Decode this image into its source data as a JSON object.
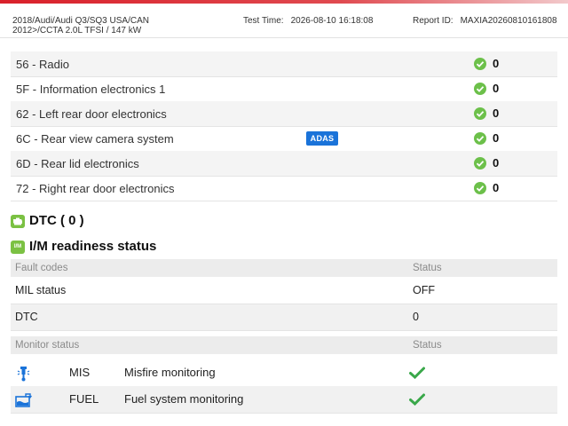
{
  "header": {
    "vehicle_line1": "2018/Audi/Audi Q3/SQ3 USA/CAN",
    "vehicle_line2": "2012>/CCTA 2.0L TFSI / 147 kW",
    "test_time_label": "Test Time:",
    "test_time_value": "2026-08-10 16:18:08",
    "report_id_label": "Report ID:",
    "report_id_value": "MAXIA20260810161808"
  },
  "systems": [
    {
      "name": "56 - Radio",
      "count": "0"
    },
    {
      "name": "5F - Information electronics 1",
      "count": "0"
    },
    {
      "name": "62 - Left rear door electronics",
      "count": "0"
    },
    {
      "name": "6C - Rear view camera system",
      "count": "0",
      "badge": "ADAS"
    },
    {
      "name": "6D - Rear lid electronics",
      "count": "0"
    },
    {
      "name": "72 - Right rear door electronics",
      "count": "0"
    }
  ],
  "dtc_section": {
    "title": "DTC ( 0 )"
  },
  "im_section": {
    "title": "I/M readiness status",
    "icon_text": "I/M",
    "fault_codes_header": "Fault codes",
    "status_header": "Status",
    "rows": [
      {
        "label": "MIL status",
        "value": "OFF"
      },
      {
        "label": "DTC",
        "value": "0"
      }
    ],
    "monitor_header": "Monitor status",
    "monitor_status_header": "Status",
    "monitors": [
      {
        "abbr": "MIS",
        "name": "Misfire monitoring",
        "icon": "misfire-icon"
      },
      {
        "abbr": "FUEL",
        "name": "Fuel system monitoring",
        "icon": "fuel-system-icon"
      }
    ]
  },
  "colors": {
    "accent_red": "#d9202a",
    "ok_green": "#6cc04a",
    "adas_blue": "#1a73d9",
    "section_green": "#7bc143"
  }
}
